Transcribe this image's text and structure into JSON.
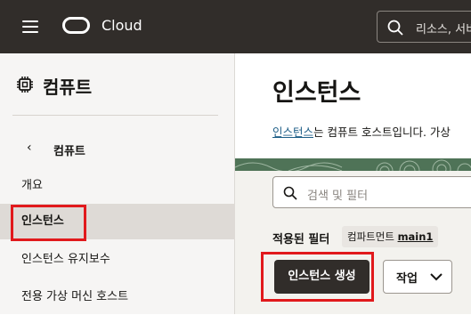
{
  "header": {
    "brand": "Cloud",
    "search_placeholder": "리소스, 서비"
  },
  "sidebar": {
    "title": "컴퓨트",
    "back_label": "컴퓨트",
    "back_glyph": "‹",
    "items": [
      {
        "label": "개요"
      },
      {
        "label": "인스턴스",
        "selected": true
      },
      {
        "label": "인스턴스 유지보수"
      },
      {
        "label": "전용 가상 머신 호스트"
      }
    ]
  },
  "main": {
    "title": "인스턴스",
    "description_link": "인스턴스",
    "description_rest": "는 컴퓨트 호스트입니다. 가상",
    "filter_placeholder": "검색 및 필터",
    "applied_filters_label": "적용된 필터",
    "chip_key": "컴파트먼트",
    "chip_value": "main1",
    "create_button": "인스턴스 생성",
    "actions_button": "작업"
  },
  "colors": {
    "topbar": "#312d2a",
    "highlight": "#e1191c",
    "link": "#1e5e87",
    "selected_item_bg": "#dedad6"
  }
}
